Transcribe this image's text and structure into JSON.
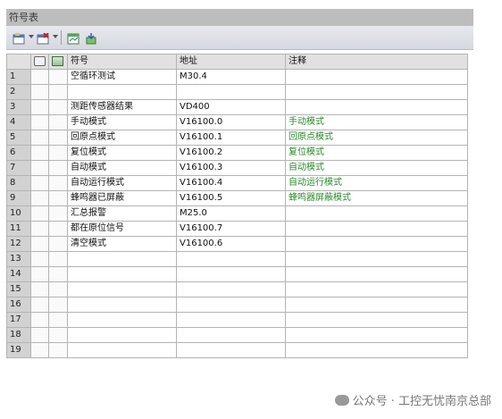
{
  "window": {
    "title": "符号表"
  },
  "toolbar": {
    "buttons": [
      {
        "icon": "insert-row-icon"
      },
      {
        "icon": "delete-row-icon"
      },
      {
        "icon": "symbol-table-icon"
      },
      {
        "icon": "apply-icon"
      }
    ]
  },
  "table": {
    "headers": [
      "",
      "",
      "",
      "符号",
      "地址",
      "注释"
    ],
    "rows": [
      {
        "n": "1",
        "symbol": "空循环测试",
        "address": "M30.4",
        "comment": ""
      },
      {
        "n": "2",
        "symbol": "",
        "address": "",
        "comment": ""
      },
      {
        "n": "3",
        "symbol": "测距传感器结果",
        "address": "VD400",
        "comment": ""
      },
      {
        "n": "4",
        "symbol": "手动模式",
        "address": "V16100.0",
        "comment": "手动模式"
      },
      {
        "n": "5",
        "symbol": "回原点模式",
        "address": "V16100.1",
        "comment": "回原点模式"
      },
      {
        "n": "6",
        "symbol": "复位模式",
        "address": "V16100.2",
        "comment": "复位模式"
      },
      {
        "n": "7",
        "symbol": "自动模式",
        "address": "V16100.3",
        "comment": "自动模式"
      },
      {
        "n": "8",
        "symbol": "自动运行模式",
        "address": "V16100.4",
        "comment": "自动运行模式"
      },
      {
        "n": "9",
        "symbol": "蜂鸣器已屏蔽",
        "address": "V16100.5",
        "comment": "蜂鸣器屏蔽模式"
      },
      {
        "n": "10",
        "symbol": "汇总报警",
        "address": "M25.0",
        "comment": ""
      },
      {
        "n": "11",
        "symbol": "都在原位信号",
        "address": "V16100.7",
        "comment": ""
      },
      {
        "n": "12",
        "symbol": "清空模式",
        "address": "V16100.6",
        "comment": ""
      },
      {
        "n": "13",
        "symbol": "",
        "address": "",
        "comment": ""
      },
      {
        "n": "14",
        "symbol": "",
        "address": "",
        "comment": ""
      },
      {
        "n": "15",
        "symbol": "",
        "address": "",
        "comment": ""
      },
      {
        "n": "16",
        "symbol": "",
        "address": "",
        "comment": ""
      },
      {
        "n": "17",
        "symbol": "",
        "address": "",
        "comment": ""
      },
      {
        "n": "18",
        "symbol": "",
        "address": "",
        "comment": ""
      },
      {
        "n": "19",
        "symbol": "",
        "address": "",
        "comment": ""
      }
    ]
  },
  "watermark": {
    "text": "公众号 · 工控无忧南京总部"
  }
}
